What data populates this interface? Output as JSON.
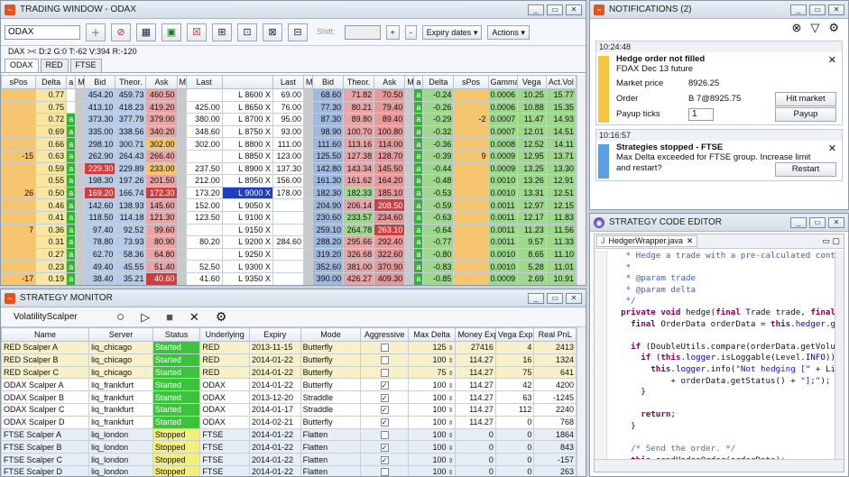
{
  "trading": {
    "title": "TRADING WINDOW - ODAX",
    "symbol": "ODAX",
    "info": "DAX >< D:2 G:0 T:-62 V:394 R:-120",
    "shift_label": "Shift:",
    "expiry_btn": "Expiry dates",
    "actions_btn": "Actions",
    "tabs": [
      "ODAX",
      "RED",
      "FTSE"
    ],
    "headers": [
      "sPos",
      "Delta",
      "a",
      "M",
      "Bid",
      "Theor.",
      "Ask",
      "M",
      "Last",
      "",
      "Last",
      "M",
      "Bid",
      "Theor.",
      "Ask",
      "M",
      "a",
      "Delta",
      "sPos",
      "Gamma",
      "Vega",
      "Act.Vol"
    ],
    "rows": [
      [
        "",
        "0.77",
        "",
        "",
        "454.20",
        "459.73",
        "460.50",
        "",
        "",
        "L 8600 X",
        "69.00",
        "",
        "68.60",
        "71.82",
        "70.50",
        "",
        "a",
        "-0.24",
        "",
        "0.0006",
        "10.25",
        "15.77"
      ],
      [
        "",
        "0.75",
        "",
        "",
        "413.10",
        "418.23",
        "419.20",
        "",
        "425.00",
        "L 8650 X",
        "76.00",
        "",
        "77.30",
        "80.21",
        "79.40",
        "",
        "a",
        "-0.26",
        "",
        "0.0006",
        "10.88",
        "15.35"
      ],
      [
        "",
        "0.72",
        "a",
        "",
        "373.30",
        "377.79",
        "379.00",
        "",
        "380.00",
        "L 8700 X",
        "95.00",
        "",
        "87.30",
        "89.80",
        "89.40",
        "",
        "a",
        "-0.29",
        "-2",
        "0.0007",
        "11.47",
        "14.93"
      ],
      [
        "",
        "0.69",
        "a",
        "",
        "335.00",
        "338.56",
        "340.20",
        "",
        "348.60",
        "L 8750 X",
        "93.00",
        "",
        "98.90",
        "100.70",
        "100.80",
        "",
        "a",
        "-0.32",
        "",
        "0.0007",
        "12.01",
        "14.51"
      ],
      [
        "",
        "0.66",
        "a",
        "",
        "298.10",
        "300.71",
        "302.00",
        "",
        "302.00",
        "L 8800 X",
        "111.00",
        "",
        "111.60",
        "113.16",
        "114.00",
        "",
        "a",
        "-0.36",
        "",
        "0.0008",
        "12.52",
        "14.11"
      ],
      [
        "-15",
        "0.63",
        "a",
        "",
        "262.90",
        "264.43",
        "266.40",
        "",
        "",
        "L 8850 X",
        "123.00",
        "",
        "125.50",
        "127.38",
        "128.70",
        "",
        "a",
        "-0.39",
        "9",
        "0.0009",
        "12.95",
        "13.71"
      ],
      [
        "",
        "0.59",
        "a",
        "",
        "229.30",
        "229.89",
        "233.00",
        "",
        "237.50",
        "L 8900 X",
        "137.30",
        "",
        "142.80",
        "143.34",
        "145.50",
        "",
        "a",
        "-0.44",
        "",
        "0.0009",
        "13.25",
        "13.30"
      ],
      [
        "",
        "0.55",
        "a",
        "",
        "198.30",
        "197.26",
        "201.50",
        "",
        "212.00",
        "L 8950 X",
        "156.00",
        "",
        "161.30",
        "161.62",
        "164.20",
        "",
        "a",
        "-0.48",
        "",
        "0.0010",
        "13.26",
        "12.91"
      ],
      [
        "26",
        "0.50",
        "a",
        "",
        "169.20",
        "166.74",
        "172.30",
        "",
        "173.20",
        "L 9000 X",
        "178.00",
        "",
        "182.30",
        "182.33",
        "185.10",
        "",
        "a",
        "-0.53",
        "",
        "0.0010",
        "13.31",
        "12.51"
      ],
      [
        "",
        "0.46",
        "a",
        "",
        "142.60",
        "138.93",
        "145.60",
        "",
        "152.00",
        "L 9050 X",
        "",
        "",
        "204.90",
        "206.14",
        "208.50",
        "",
        "a",
        "-0.59",
        "",
        "0.0011",
        "12.97",
        "12.15"
      ],
      [
        "",
        "0.41",
        "a",
        "",
        "118.50",
        "114.18",
        "121.30",
        "",
        "123.50",
        "L 9100 X",
        "",
        "",
        "230.60",
        "233.57",
        "234.60",
        "",
        "a",
        "-0.63",
        "",
        "0.0011",
        "12.17",
        "11.83"
      ],
      [
        "7",
        "0.36",
        "a",
        "",
        "97.40",
        "92.52",
        "99.60",
        "",
        "",
        "L 9150 X",
        "",
        "",
        "259.10",
        "264.78",
        "263.10",
        "",
        "a",
        "-0.64",
        "",
        "0.0011",
        "11.23",
        "11.56"
      ],
      [
        "",
        "0.31",
        "a",
        "",
        "78.80",
        "73.93",
        "80.90",
        "",
        "80.20",
        "L 9200 X",
        "284.60",
        "",
        "288.20",
        "295.66",
        "292.40",
        "",
        "a",
        "-0.77",
        "",
        "0.0011",
        "9.57",
        "11.33"
      ],
      [
        "",
        "0.27",
        "a",
        "",
        "62.70",
        "58.36",
        "64.80",
        "",
        "",
        "L 9250 X",
        "",
        "",
        "319.20",
        "326.68",
        "322.60",
        "",
        "a",
        "-0.80",
        "",
        "0.0010",
        "8.65",
        "11.10"
      ],
      [
        "",
        "0.23",
        "a",
        "",
        "49.40",
        "45.55",
        "51.40",
        "",
        "52.50",
        "L 9300 X",
        "",
        "",
        "352.60",
        "381.00",
        "370.90",
        "",
        "a",
        "-0.83",
        "",
        "0.0010",
        "5.28",
        "11.01"
      ],
      [
        "-17",
        "0.19",
        "a",
        "",
        "38.40",
        "35.21",
        "40.60",
        "",
        "41.60",
        "L 9350 X",
        "",
        "",
        "390.00",
        "426.27",
        "409.30",
        "",
        "a",
        "-0.85",
        "",
        "0.0009",
        "2.69",
        "10.91"
      ],
      [
        "",
        "0.16",
        "a",
        "",
        "29.70",
        "27.05",
        "31.70",
        "",
        "31.00",
        "L 9400 X",
        "",
        "",
        "431.10",
        "475.67",
        "450.60",
        "",
        "a",
        "-0.92",
        "",
        "0.0009",
        "0.00",
        "10.81"
      ],
      [
        "",
        "0.13",
        "a",
        "",
        "22.70",
        "20.71",
        "24.40",
        "",
        "24.80",
        "L 9450 X",
        "",
        "",
        "473.90",
        "525.67",
        "497.90",
        "",
        "a",
        "-0.98",
        "",
        "0.0003",
        "0.00",
        "10.84"
      ]
    ]
  },
  "monitor": {
    "title": "STRATEGY MONITOR",
    "strategy": "VolatilityScalper",
    "headers": [
      "Name",
      "Server",
      "Status",
      "Underlying",
      "Expiry",
      "Mode",
      "Aggressive",
      "Max Delta",
      "Money Exp",
      "Vega Exp",
      "Real PnL"
    ],
    "rows": [
      [
        "RED Scalper A",
        "liq_chicago",
        "Started",
        "RED",
        "2013-11-15",
        "Butterfly",
        "",
        "125",
        "27416",
        "4",
        "2413"
      ],
      [
        "RED Scalper B",
        "liq_chicago",
        "Started",
        "RED",
        "2014-01-22",
        "Butterfly",
        "",
        "100",
        "114.27",
        "16",
        "1324"
      ],
      [
        "RED Scalper C",
        "liq_chicago",
        "Started",
        "RED",
        "2014-01-22",
        "Butterfly",
        "",
        "75",
        "114.27",
        "75",
        "641"
      ],
      [
        "ODAX Scalper A",
        "liq_frankfurt",
        "Started",
        "ODAX",
        "2014-01-22",
        "Butterfly",
        "✓",
        "100",
        "114.27",
        "42",
        "4200"
      ],
      [
        "ODAX Scalper B",
        "liq_frankfurt",
        "Started",
        "ODAX",
        "2013-12-20",
        "Straddle",
        "✓",
        "100",
        "114.27",
        "63",
        "-1245"
      ],
      [
        "ODAX Scalper C",
        "liq_frankfurt",
        "Started",
        "ODAX",
        "2014-01-17",
        "Straddle",
        "✓",
        "100",
        "114.27",
        "112",
        "2240"
      ],
      [
        "ODAX Scalper D",
        "liq_frankfurt",
        "Started",
        "ODAX",
        "2014-02-21",
        "Butterfly",
        "✓",
        "100",
        "114.27",
        "0",
        "768"
      ],
      [
        "FTSE Scalper A",
        "liq_london",
        "Stopped",
        "FTSE",
        "2014-01-22",
        "Flatten",
        "",
        "100",
        "0",
        "0",
        "1864"
      ],
      [
        "FTSE Scalper B",
        "liq_london",
        "Stopped",
        "FTSE",
        "2014-01-22",
        "Flatten",
        "✓",
        "100",
        "0",
        "0",
        "843"
      ],
      [
        "FTSE Scalper C",
        "liq_london",
        "Stopped",
        "FTSE",
        "2014-01-22",
        "Flatten",
        "✓",
        "100",
        "0",
        "0",
        "-157"
      ],
      [
        "FTSE Scalper D",
        "liq_london",
        "Stopped",
        "FTSE",
        "2014-01-22",
        "Flatten",
        "",
        "100",
        "0",
        "0",
        "263"
      ]
    ]
  },
  "notifications": {
    "title": "NOTIFICATIONS (2)",
    "n1": {
      "time": "10:24:48",
      "title": "Hedge order not filled",
      "sub": "FDAX Dec 13 future",
      "k1": "Market price",
      "v1": "8926.25",
      "k2": "Order",
      "v2": "B 7@8925.75",
      "k3": "Payup ticks",
      "v3": "1",
      "btn1": "Hit market",
      "btn2": "Payup"
    },
    "n2": {
      "time": "10:16:57",
      "title": "Strategies stopped - FTSE",
      "msg1": "Max Delta exceeded for FTSE group. Increase limit",
      "msg2": "and restart?",
      "btn": "Restart"
    }
  },
  "editor": {
    "title": "STRATEGY CODE EDITOR",
    "file": "HedgerWrapper.java"
  },
  "colors": {
    "accent": "#e2551f",
    "started": "#3dc23d",
    "stopped": "#f4ef7a",
    "warn": "#f5c542",
    "info": "#5aa0e0"
  }
}
